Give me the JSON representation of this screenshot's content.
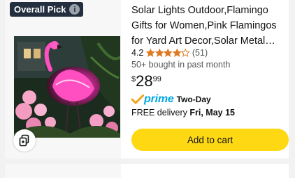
{
  "badge": {
    "label": "Overall Pick",
    "info_glyph": "i"
  },
  "product": {
    "title": "Solar Lights Outdoor,Flamingo Gifts for Women,Pink Flamingos for Yard Art Decor,Solar Metal Flamingo Ligh...",
    "rating": "4.2",
    "rating_value": 4.2,
    "review_count": "(51)",
    "bought": "50+ bought in past month",
    "price": {
      "currency": "$",
      "whole": "28",
      "fraction": "99"
    },
    "prime": {
      "word": "prime",
      "speed": "Two-Day"
    },
    "delivery": {
      "prefix": "FREE delivery",
      "date": "Fri, May 15"
    },
    "add_to_cart": "Add to cart"
  },
  "icons": {
    "badge_info": "info-icon",
    "compare": "compare-icon",
    "stars": "star-icon",
    "prime_check": "prime-check-icon"
  },
  "colors": {
    "star": "#de7921",
    "prime": "#00a8e1",
    "cart_button": "#ffd814",
    "badge_bg": "#232f3e"
  }
}
